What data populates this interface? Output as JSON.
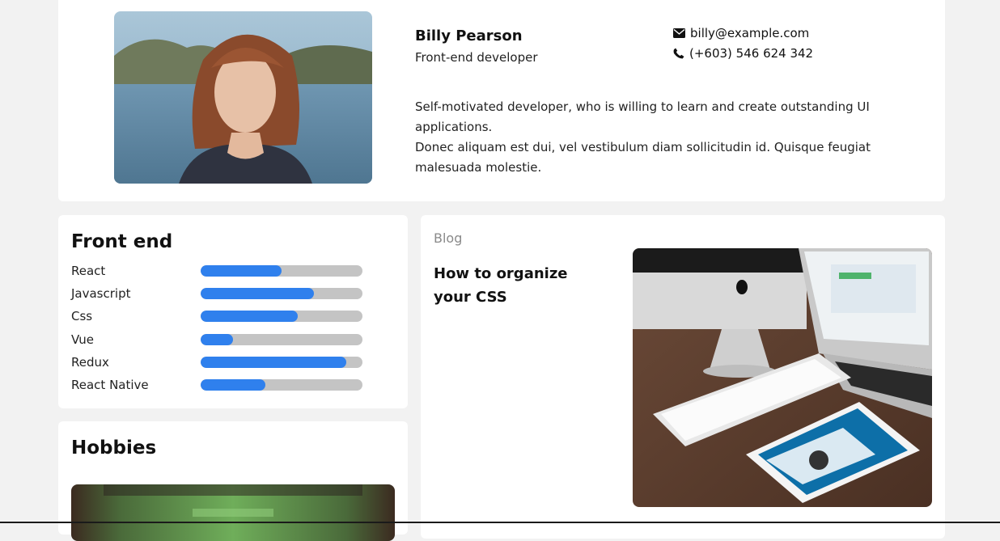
{
  "profile": {
    "name": "Billy Pearson",
    "role": "Front-end developer",
    "email": "billy@example.com",
    "phone": "(+603) 546 624 342",
    "bio_line1": "Self-motivated developer, who is willing to learn and create outstanding UI applications.",
    "bio_line2": "Donec aliquam est dui, vel vestibulum diam sollicitudin id. Quisque feugiat malesuada molestie.",
    "icons": {
      "email": "envelope-icon",
      "phone": "phone-icon"
    }
  },
  "skills": {
    "title": "Front end",
    "items": [
      {
        "label": "React",
        "level": 0.5
      },
      {
        "label": "Javascript",
        "level": 0.7
      },
      {
        "label": "Css",
        "level": 0.6
      },
      {
        "label": "Vue",
        "level": 0.2
      },
      {
        "label": "Redux",
        "level": 0.9
      },
      {
        "label": "React Native",
        "level": 0.4
      }
    ]
  },
  "hobbies": {
    "title": "Hobbies"
  },
  "blog": {
    "label": "Blog",
    "post_title": "How to organize your CSS"
  },
  "colors": {
    "accent": "#2f80ed",
    "track": "#c4c4c4",
    "background": "#f2f2f2",
    "card": "#ffffff"
  }
}
